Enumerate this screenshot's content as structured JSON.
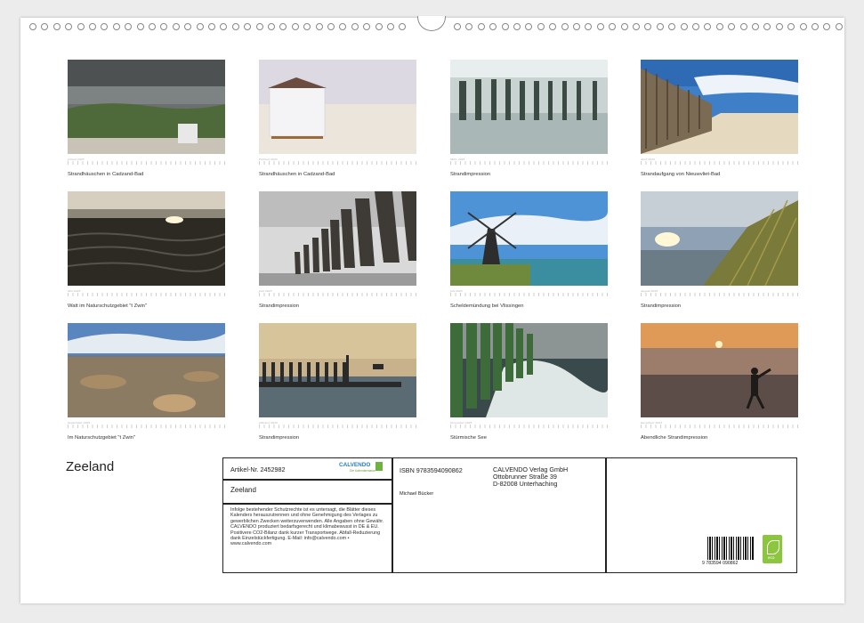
{
  "calendar": {
    "title": "Zeeland",
    "months": [
      {
        "month": "Januar 2025",
        "caption": "Strandhäuschen in Cadzand-Bad"
      },
      {
        "month": "Februar 2025",
        "caption": "Strandhäuschen in Cadzand-Bad"
      },
      {
        "month": "März 2025",
        "caption": "Strandimpression"
      },
      {
        "month": "April 2025",
        "caption": "Strandaufgang von Nieuwvliet-Bad"
      },
      {
        "month": "Mai 2025",
        "caption": "Watt im Naturschutzgebiet \"t Zwin\""
      },
      {
        "month": "Juni 2025",
        "caption": "Strandimpression"
      },
      {
        "month": "Juli 2025",
        "caption": "Scheldemündung bei Vlissingen"
      },
      {
        "month": "August 2025",
        "caption": "Strandimpression"
      },
      {
        "month": "September 2025",
        "caption": "Im Naturschutzgebiet \"t Zwin\""
      },
      {
        "month": "Oktober 2025",
        "caption": "Strandimpression"
      },
      {
        "month": "November 2025",
        "caption": "Stürmische See"
      },
      {
        "month": "Dezember 2025",
        "caption": "Abendliche Strandimpression"
      }
    ]
  },
  "info": {
    "article_no": "Artikel-Nr. 2452982",
    "calvendo_logo": "CALVENDO",
    "calvendo_tagline": "Die Kalendermarke",
    "title": "Zeeland",
    "legal": "Infolge bestehender Schutzrechte ist es untersagt, die Blätter dieses Kalenders herauszutrennen und ohne Genehmigung des Verlages zu gewerblichen Zwecken weiterzuverwenden. Alle Angaben ohne Gewähr. CALVENDO produziert bedarfsgerecht und klimabewusst in DE & EU. Positivere CO2-Bilanz dank kurzer Transportwege. Abfall-Reduzierung dank Einzelstückfertigung. E-Mail: info@calvendo.com • www.calvendo.com",
    "isbn": "ISBN 9783594090862",
    "author": "Michael Bücker",
    "publisher_name": "CALVENDO Verlag GmbH",
    "publisher_street": "Ottobrunner Straße 39",
    "publisher_city": "D-82008 Unterhaching",
    "barcode_number": "9 783594 090862",
    "eco_label": "eco"
  }
}
